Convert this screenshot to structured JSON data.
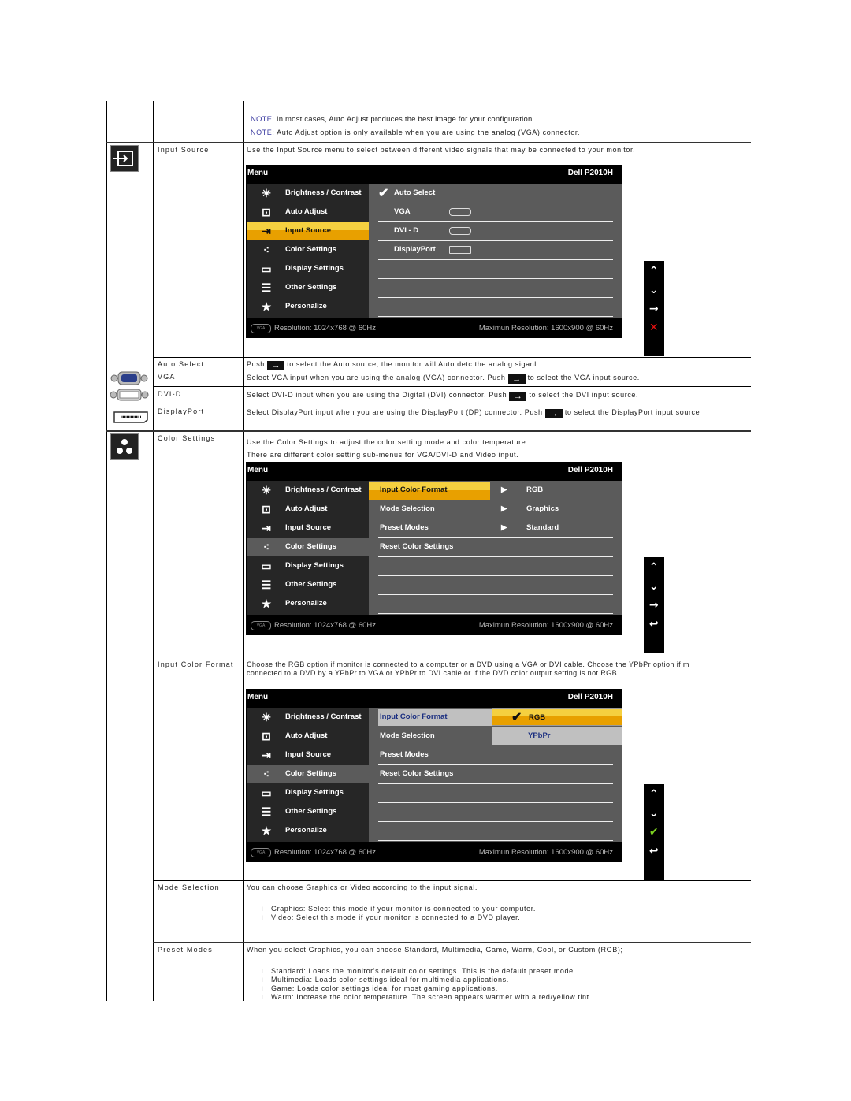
{
  "notes": [
    {
      "label": "NOTE:",
      "text": " In most cases, Auto Adjust produces the best image for your configuration."
    },
    {
      "label": "NOTE:",
      "text": " Auto Adjust option is only available when you are using the analog (VGA) connector."
    }
  ],
  "input_source": {
    "icon": "input-source-icon",
    "label": "Input Source",
    "description": "Use the Input Source menu to select between different video signals that may be connected to your monitor.",
    "osd": {
      "title": "Menu",
      "model": "Dell P2010H",
      "menu_items": [
        {
          "icon": "brightness-icon",
          "label": "Brightness / Contrast"
        },
        {
          "icon": "auto-adjust-icon",
          "label": "Auto Adjust"
        },
        {
          "icon": "input-source-icon",
          "label": "Input Source",
          "selected": true
        },
        {
          "icon": "color-settings-icon",
          "label": "Color Settings"
        },
        {
          "icon": "display-settings-icon",
          "label": "Display Settings"
        },
        {
          "icon": "other-settings-icon",
          "label": "Other Settings"
        },
        {
          "icon": "personalize-star-icon",
          "label": "Personalize"
        }
      ],
      "options": [
        {
          "label": "Auto Select",
          "checked": true
        },
        {
          "label": "VGA",
          "connector": "vga-connector-icon"
        },
        {
          "label": "DVI - D",
          "connector": "dvi-connector-icon"
        },
        {
          "label": "DisplayPort",
          "connector": "displayport-connector-icon"
        }
      ],
      "footer_resolution": "Resolution: 1024x768 @ 60Hz",
      "footer_max": "Maximun Resolution: 1600x900 @ 60Hz"
    },
    "buttons": [
      "up-arrow-icon",
      "down-arrow-icon",
      "right-arrow-icon",
      "exit-x-icon"
    ],
    "sub_rows": [
      {
        "label": "Auto Select",
        "pre": "Push ",
        "post": " to select the Auto source, the monitor will Auto detc the analog siganl."
      },
      {
        "label": "VGA",
        "icon": "vga-connector-icon",
        "pre": "Select VGA input when you are using the analog (VGA) connector. Push ",
        "post": " to select the VGA input source."
      },
      {
        "label": "DVI-D",
        "icon": "dvi-connector-icon",
        "pre": "Select DVI-D input when you are using the Digital (DVI) connector. Push ",
        "post": " to select the DVI input source."
      },
      {
        "label": "DisplayPort",
        "icon": "displayport-connector-icon",
        "pre": "Select DisplayPort input when you are using the DisplayPort (DP) connector. Push ",
        "post": " to select the DisplayPort input source"
      }
    ]
  },
  "color_settings": {
    "icon": "color-settings-icon",
    "label": "Color Settings",
    "description_1": "Use the Color Settings to adjust the color setting mode and color temperature.",
    "description_2": "There are different color setting sub-menus for VGA/DVI-D and Video input.",
    "osd": {
      "title": "Menu",
      "model": "Dell P2010H",
      "menu_items": [
        {
          "label": "Brightness / Contrast"
        },
        {
          "label": "Auto Adjust"
        },
        {
          "label": "Input Source"
        },
        {
          "label": "Color Settings",
          "selected": true
        },
        {
          "label": "Display Settings"
        },
        {
          "label": "Other Settings"
        },
        {
          "label": "Personalize"
        }
      ],
      "options": [
        {
          "label": "Input Color Format",
          "value": "RGB",
          "highlighted": true
        },
        {
          "label": "Mode Selection",
          "value": "Graphics"
        },
        {
          "label": "Preset Modes",
          "value": "Standard"
        },
        {
          "label": "Reset Color Settings",
          "value": ""
        }
      ],
      "footer_resolution": "Resolution: 1024x768 @ 60Hz",
      "footer_max": "Maximun Resolution: 1600x900 @ 60Hz"
    },
    "buttons": [
      "up-arrow-icon",
      "down-arrow-icon",
      "right-arrow-icon",
      "back-icon"
    ]
  },
  "input_color_format": {
    "label": "Input Color Format",
    "description_1": "Choose the RGB option if monitor is connected to a computer or a DVD using a VGA or DVI cable. Choose the YPbPr option if m",
    "description_2": "connected to a DVD by a YPbPr to VGA or YPbPr to DVI cable or if the DVD color output setting is not RGB.",
    "osd": {
      "title": "Menu",
      "model": "Dell P2010H",
      "options": [
        {
          "label": "Input Color Format"
        },
        {
          "label": "Mode Selection"
        },
        {
          "label": "Preset Modes"
        },
        {
          "label": "Reset Color Settings"
        }
      ],
      "choices": [
        {
          "label": "RGB",
          "checked": true
        },
        {
          "label": "YPbPr"
        }
      ],
      "footer_resolution": "Resolution: 1024x768 @ 60Hz",
      "footer_max": "Maximun Resolution: 1600x900 @ 60Hz"
    },
    "buttons": [
      "up-arrow-icon",
      "down-arrow-icon",
      "check-icon",
      "back-icon"
    ]
  },
  "mode_selection": {
    "label": "Mode Selection",
    "description": "You can choose Graphics or Video according to the input signal.",
    "bullets": [
      "Graphics: Select this mode if your monitor is connected to your computer.",
      "Video: Select this mode if your monitor is connected to a DVD player."
    ]
  },
  "preset_modes": {
    "label": "Preset Modes",
    "description": "When you select Graphics, you can choose Standard, Multimedia, Game, Warm, Cool, or Custom (RGB);",
    "bullets": [
      "Standard: Loads the monitor's default color settings. This is the default preset mode.",
      "Multimedia: Loads color settings ideal for multimedia applications.",
      "Game: Loads color settings ideal for most gaming applications.",
      "Warm: Increase the color temperature. The screen appears warmer with a red/yellow tint."
    ]
  },
  "colors": {
    "note": "#3a3aa0",
    "osd_highlight": "#e8a000",
    "exit_red": "#e01010",
    "check_green": "#7ed321"
  }
}
